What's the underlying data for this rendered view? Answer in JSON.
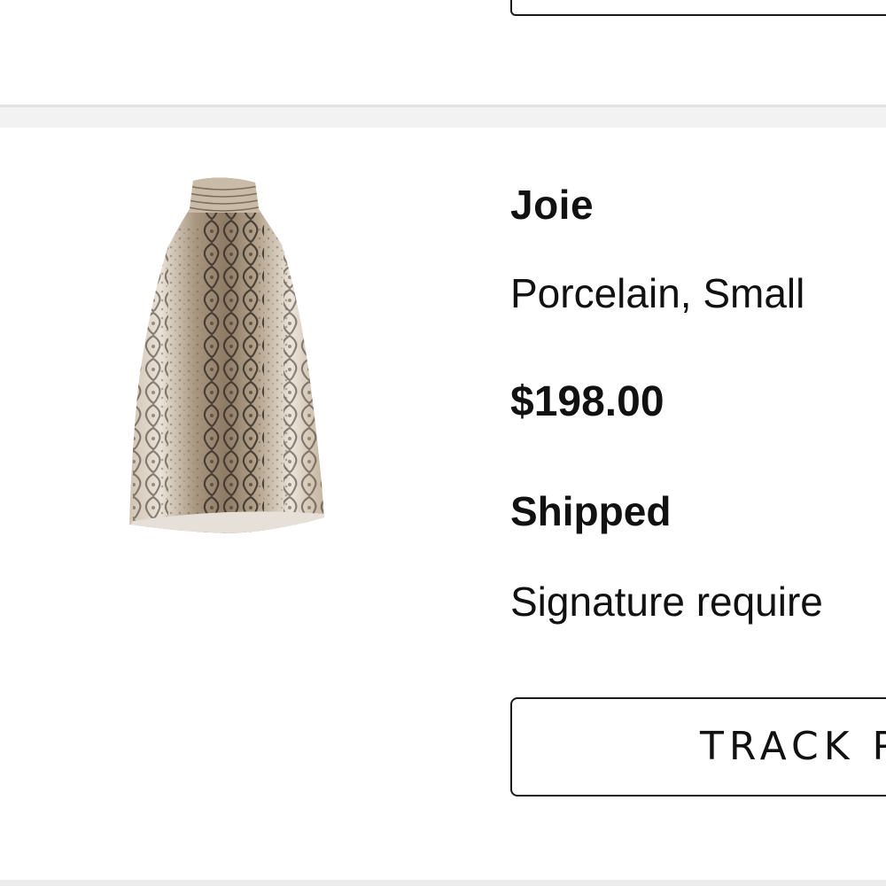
{
  "order_item": {
    "brand": "Joie",
    "variant": "Porcelain, Small",
    "price": "$198.00",
    "status": "Shipped",
    "note": "Signature require",
    "track_button_label": "TRACK P",
    "image_icon": "snakeskin-halter-top-image"
  },
  "colors": {
    "text": "#111111",
    "divider": "#f2f2f2",
    "button_border": "#1a1a1a"
  }
}
